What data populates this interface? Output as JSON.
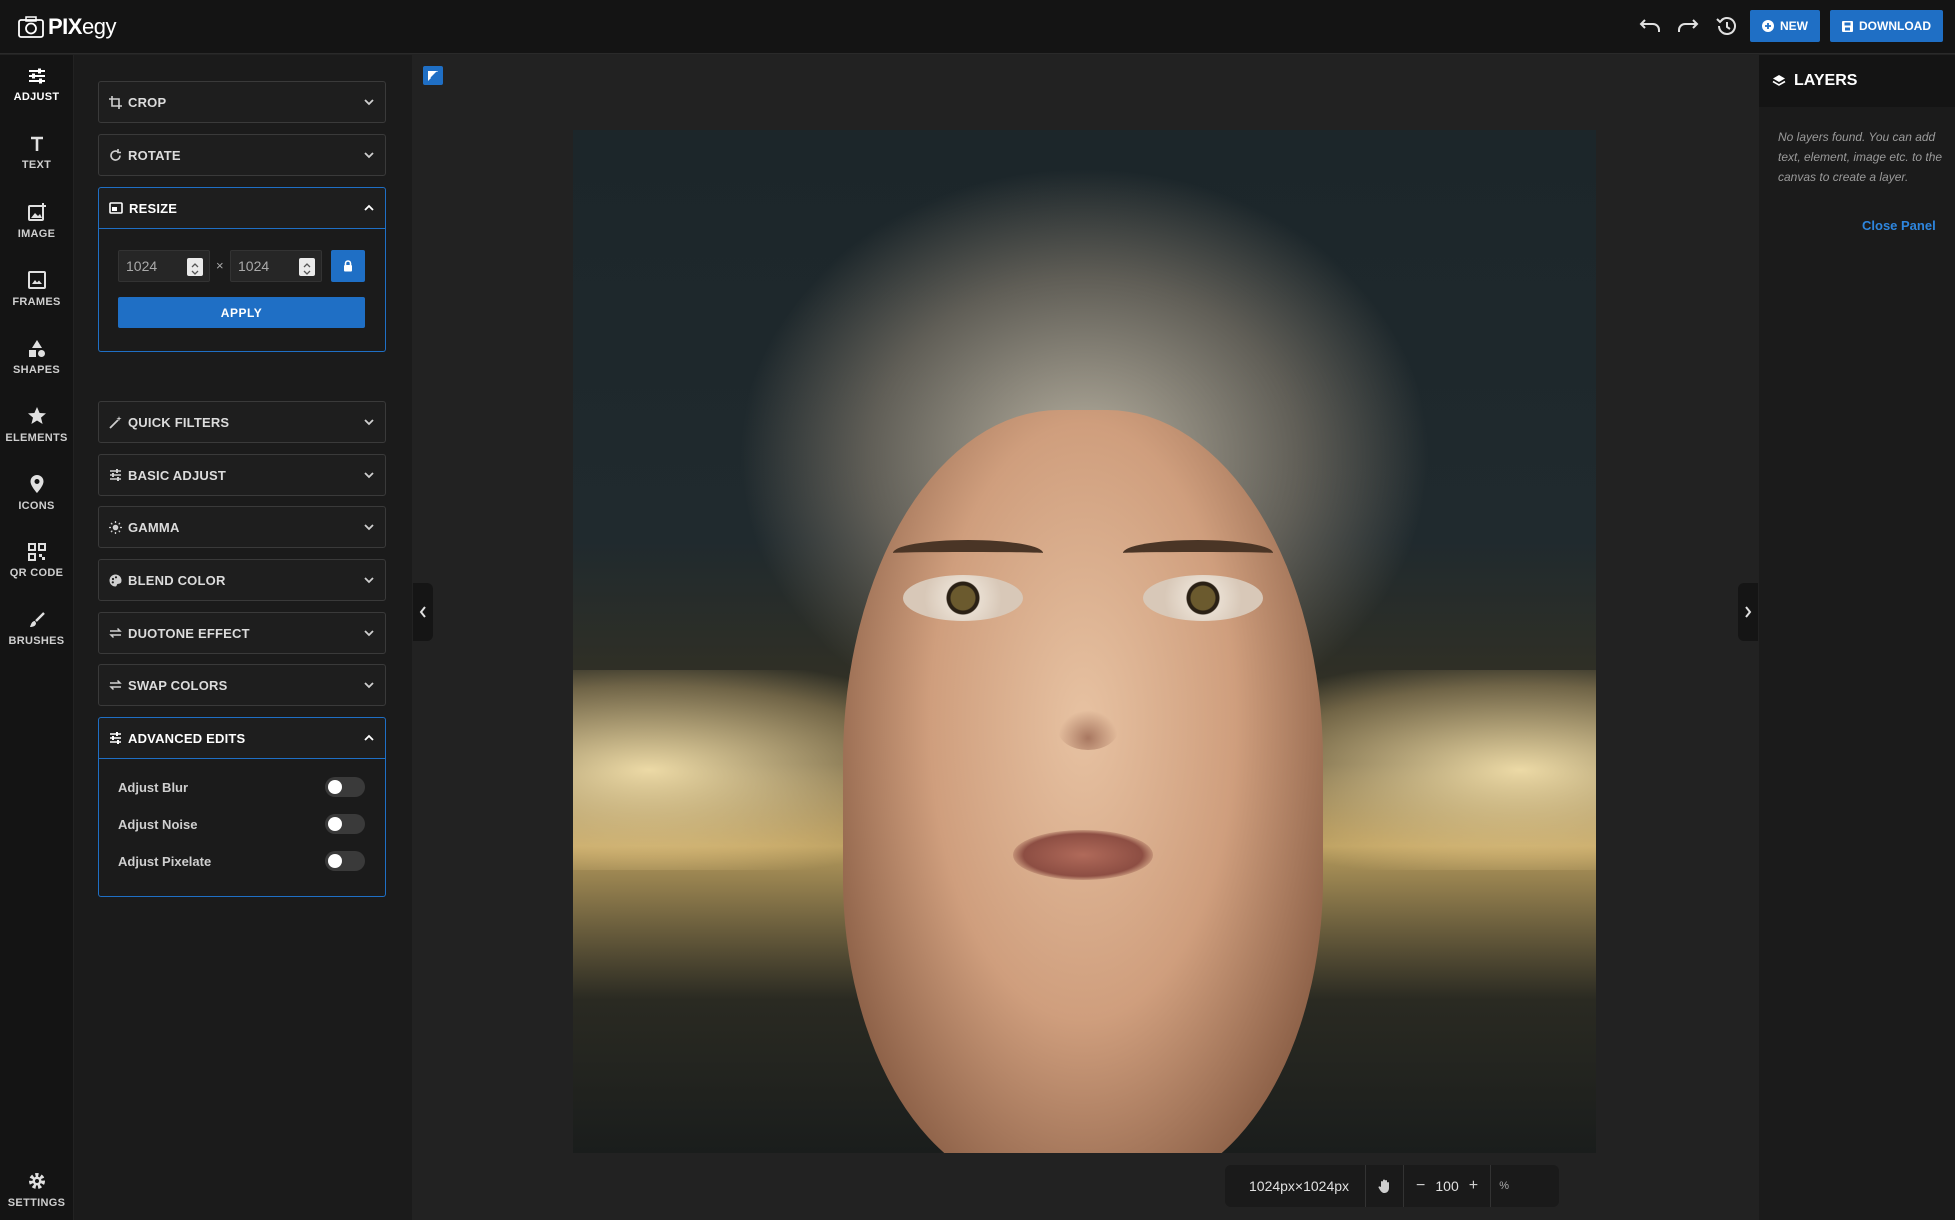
{
  "app": {
    "brand_prefix": "PIX",
    "brand_suffix": "egy"
  },
  "header": {
    "undo_icon": "undo-icon",
    "redo_icon": "redo-icon",
    "history_icon": "history-icon",
    "new_label": "NEW",
    "download_label": "DOWNLOAD",
    "accent_color": "#1f6fc5"
  },
  "sidebar": {
    "items": [
      {
        "label": "ADJUST",
        "icon": "sliders-icon",
        "active": true
      },
      {
        "label": "TEXT",
        "icon": "text-icon"
      },
      {
        "label": "IMAGE",
        "icon": "image-add-icon"
      },
      {
        "label": "FRAMES",
        "icon": "frame-icon"
      },
      {
        "label": "SHAPES",
        "icon": "shapes-icon"
      },
      {
        "label": "ELEMENTS",
        "icon": "star-icon"
      },
      {
        "label": "ICONS",
        "icon": "map-pin-icon"
      },
      {
        "label": "QR CODE",
        "icon": "qr-code-icon"
      },
      {
        "label": "BRUSHES",
        "icon": "brush-icon"
      }
    ],
    "settings_label": "SETTINGS"
  },
  "adjust_panel": {
    "crop": "CROP",
    "rotate": "ROTATE",
    "resize": {
      "title": "RESIZE",
      "width": "1024",
      "height": "1024",
      "times": "×",
      "apply": "APPLY"
    },
    "quick_filters": "QUICK FILTERS",
    "basic_adjust": "BASIC ADJUST",
    "gamma": "GAMMA",
    "blend_color": "BLEND COLOR",
    "duotone_effect": "DUOTONE EFFECT",
    "swap_colors": "SWAP COLORS",
    "advanced_edits": {
      "title": "ADVANCED EDITS",
      "toggles": [
        {
          "label": "Adjust Blur",
          "on": false
        },
        {
          "label": "Adjust Noise",
          "on": false
        },
        {
          "label": "Adjust Pixelate",
          "on": false
        }
      ]
    }
  },
  "canvas": {
    "dimensions": "1024px×1024px",
    "zoom": "100",
    "zoom_unit": "%"
  },
  "layers_panel": {
    "title": "LAYERS",
    "message": "No layers found. You can add text, element, image etc. to the canvas to create a layer.",
    "close_label": "Close Panel"
  }
}
